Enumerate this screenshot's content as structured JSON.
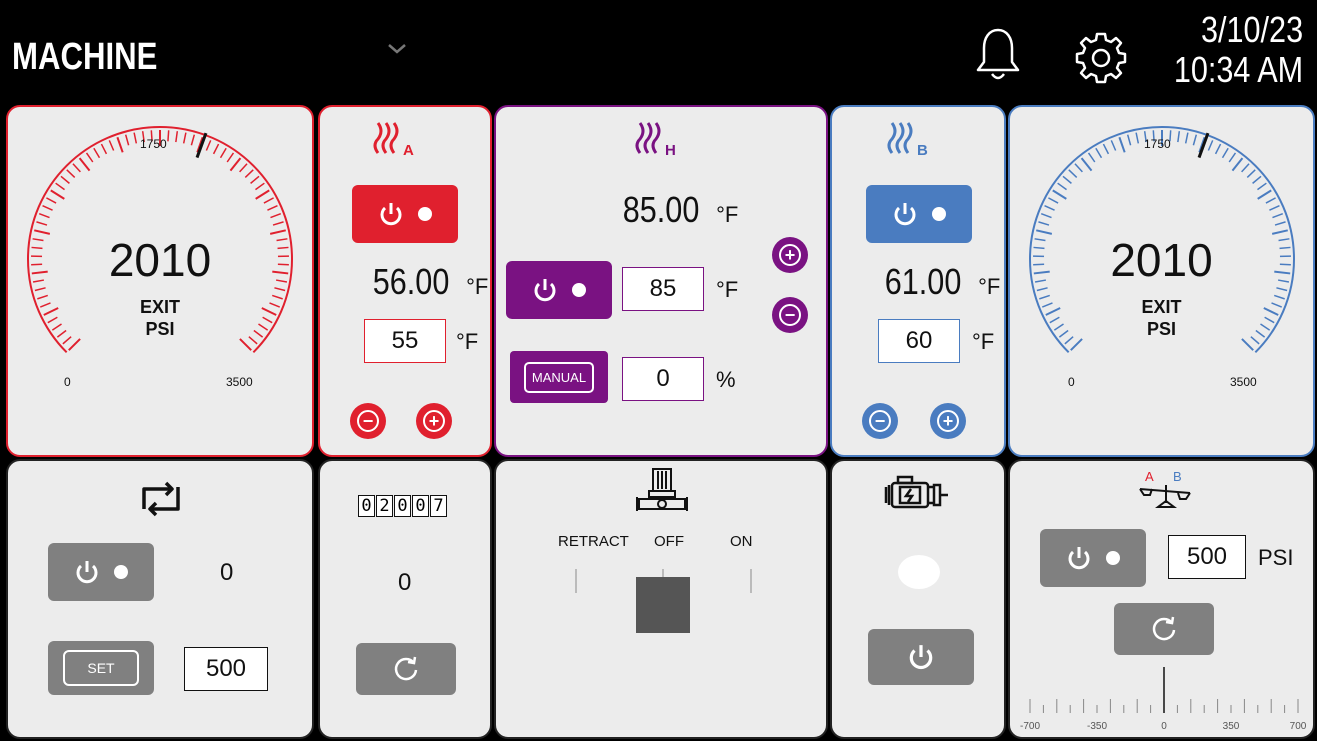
{
  "header": {
    "title": "MACHINE",
    "date": "3/10/23",
    "time": "10:34 AM"
  },
  "gauge_a": {
    "value": "2010",
    "label1": "EXIT",
    "label2": "PSI",
    "min": "0",
    "mid": "1750",
    "max": "3500",
    "reading": 2010,
    "range_max": 3500,
    "color": "#e0202e"
  },
  "gauge_b": {
    "value": "2010",
    "label1": "EXIT",
    "label2": "PSI",
    "min": "0",
    "mid": "1750",
    "max": "3500",
    "reading": 2010,
    "range_max": 3500,
    "color": "#4a7cc0"
  },
  "heater_a": {
    "subscript": "A",
    "temp": "56.00",
    "temp_unit": "°F",
    "setpoint": "55",
    "setpoint_unit": "°F"
  },
  "heater_h": {
    "subscript": "H",
    "temp": "85.00",
    "temp_unit": "°F",
    "setpoint": "85",
    "setpoint_unit": "°F",
    "manual_label": "MANUAL",
    "manual_value": "0",
    "manual_unit": "%"
  },
  "heater_b": {
    "subscript": "B",
    "temp": "61.00",
    "temp_unit": "°F",
    "setpoint": "60",
    "setpoint_unit": "°F"
  },
  "recirc": {
    "value": "0",
    "set_label": "SET",
    "set_value": "500"
  },
  "counter": {
    "digits": [
      "0",
      "2",
      "0",
      "0",
      "7"
    ],
    "value": "0"
  },
  "pump": {
    "label_retract": "RETRACT",
    "label_off": "OFF",
    "label_on": "ON",
    "position": "OFF"
  },
  "balance": {
    "label_a": "A",
    "label_b": "B",
    "setpoint": "500",
    "unit": "PSI",
    "scale": [
      "-700",
      "-350",
      "0",
      "350",
      "700"
    ],
    "reading": 0
  },
  "colors": {
    "red": "#e0202e",
    "purple": "#7a1282",
    "blue": "#4a7cc0",
    "gray": "#808080"
  }
}
